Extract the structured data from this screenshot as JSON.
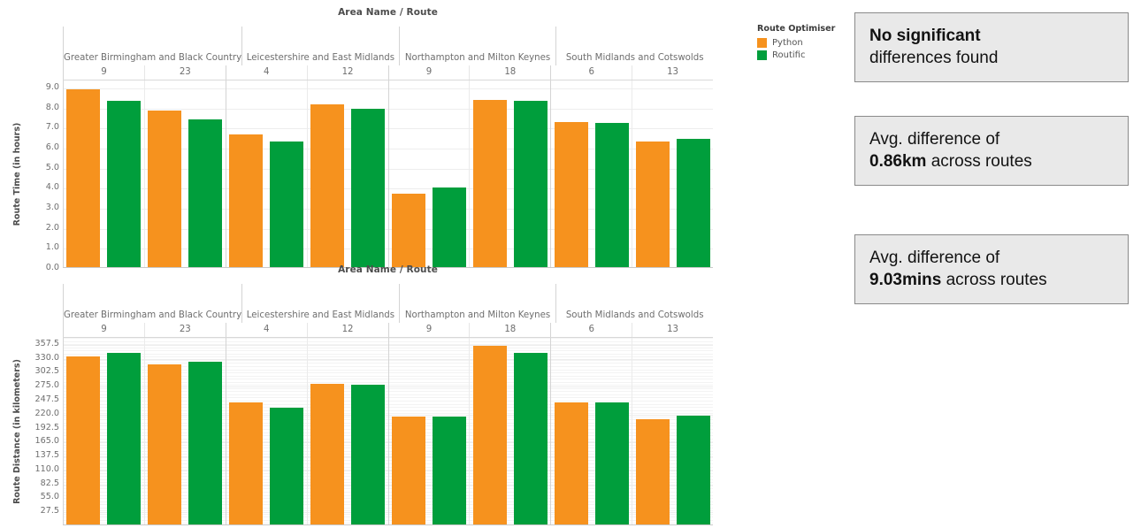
{
  "legend": {
    "title": "Route Optimiser",
    "items": [
      {
        "label": "Python",
        "color": "#f6921e",
        "icon": "legend-swatch-python"
      },
      {
        "label": "Routific",
        "color": "#009e3c",
        "icon": "legend-swatch-routific"
      }
    ]
  },
  "cards": [
    {
      "bold_first": true,
      "bold": "No significant",
      "rest": "differences found"
    },
    {
      "bold_first": false,
      "lead": "Avg. difference of",
      "bold": "0.86km",
      "rest": "across routes"
    },
    {
      "bold_first": false,
      "lead": "Avg. difference of",
      "bold": "9.03mins",
      "rest": "across routes"
    }
  ],
  "header": {
    "column_title": "Area Name / Route",
    "areas": [
      "Greater Birmingham and Black Country",
      "Leicestershire and East Midlands",
      "Northampton and Milton Keynes",
      "South Midlands and Cotswolds"
    ],
    "routes": [
      "9",
      "23",
      "4",
      "12",
      "9",
      "18",
      "6",
      "13"
    ]
  },
  "chart_data": [
    {
      "type": "bar",
      "id": "route-time",
      "title": "Area Name / Route",
      "xlabel": "Area Name / Route",
      "ylabel": "Route Time (in hours)",
      "ylim": [
        0,
        9.4
      ],
      "grid": true,
      "legend_position": "right",
      "areas": [
        "Greater Birmingham and Black Country",
        "Leicestershire and East Midlands",
        "Northampton and Milton Keynes",
        "South Midlands and Cotswolds"
      ],
      "categories": [
        "9",
        "23",
        "4",
        "12",
        "9",
        "18",
        "6",
        "13"
      ],
      "ticks": [
        "0.0",
        "1.0",
        "2.0",
        "3.0",
        "4.0",
        "5.0",
        "6.0",
        "7.0",
        "8.0",
        "9.0"
      ],
      "tick_values": [
        0,
        1,
        2,
        3,
        4,
        5,
        6,
        7,
        8,
        9
      ],
      "series": [
        {
          "name": "Python",
          "color": "#f6921e",
          "values": [
            8.86,
            7.8,
            6.6,
            8.13,
            3.65,
            8.35,
            7.25,
            6.25
          ]
        },
        {
          "name": "Routific",
          "color": "#009e3c",
          "values": [
            8.3,
            7.38,
            6.28,
            7.9,
            3.97,
            8.28,
            7.18,
            6.42
          ]
        }
      ]
    },
    {
      "type": "bar",
      "id": "route-distance",
      "title": "Area Name / Route",
      "xlabel": "Area Name / Route",
      "ylabel": "Route Distance (in kilometers)",
      "ylim": [
        0,
        371.25
      ],
      "grid": true,
      "legend_position": "right",
      "areas": [
        "Greater Birmingham and Black Country",
        "Leicestershire and East Midlands",
        "Northampton and Milton Keynes",
        "South Midlands and Cotswolds"
      ],
      "categories": [
        "9",
        "23",
        "4",
        "12",
        "9",
        "18",
        "6",
        "13"
      ],
      "ticks": [
        "27.5",
        "55.0",
        "82.5",
        "110.0",
        "137.5",
        "165.0",
        "192.5",
        "220.0",
        "247.5",
        "275.0",
        "302.5",
        "330.0",
        "357.5"
      ],
      "tick_values": [
        27.5,
        55,
        82.5,
        110,
        137.5,
        165,
        192.5,
        220,
        247.5,
        275,
        302.5,
        330,
        357.5
      ],
      "series": [
        {
          "name": "Python",
          "color": "#f6921e",
          "values": [
            332,
            316,
            240,
            277,
            213,
            352,
            240,
            207
          ]
        },
        {
          "name": "Routific",
          "color": "#009e3c",
          "values": [
            338,
            320,
            230,
            275,
            213,
            338,
            241,
            214
          ]
        }
      ]
    }
  ]
}
